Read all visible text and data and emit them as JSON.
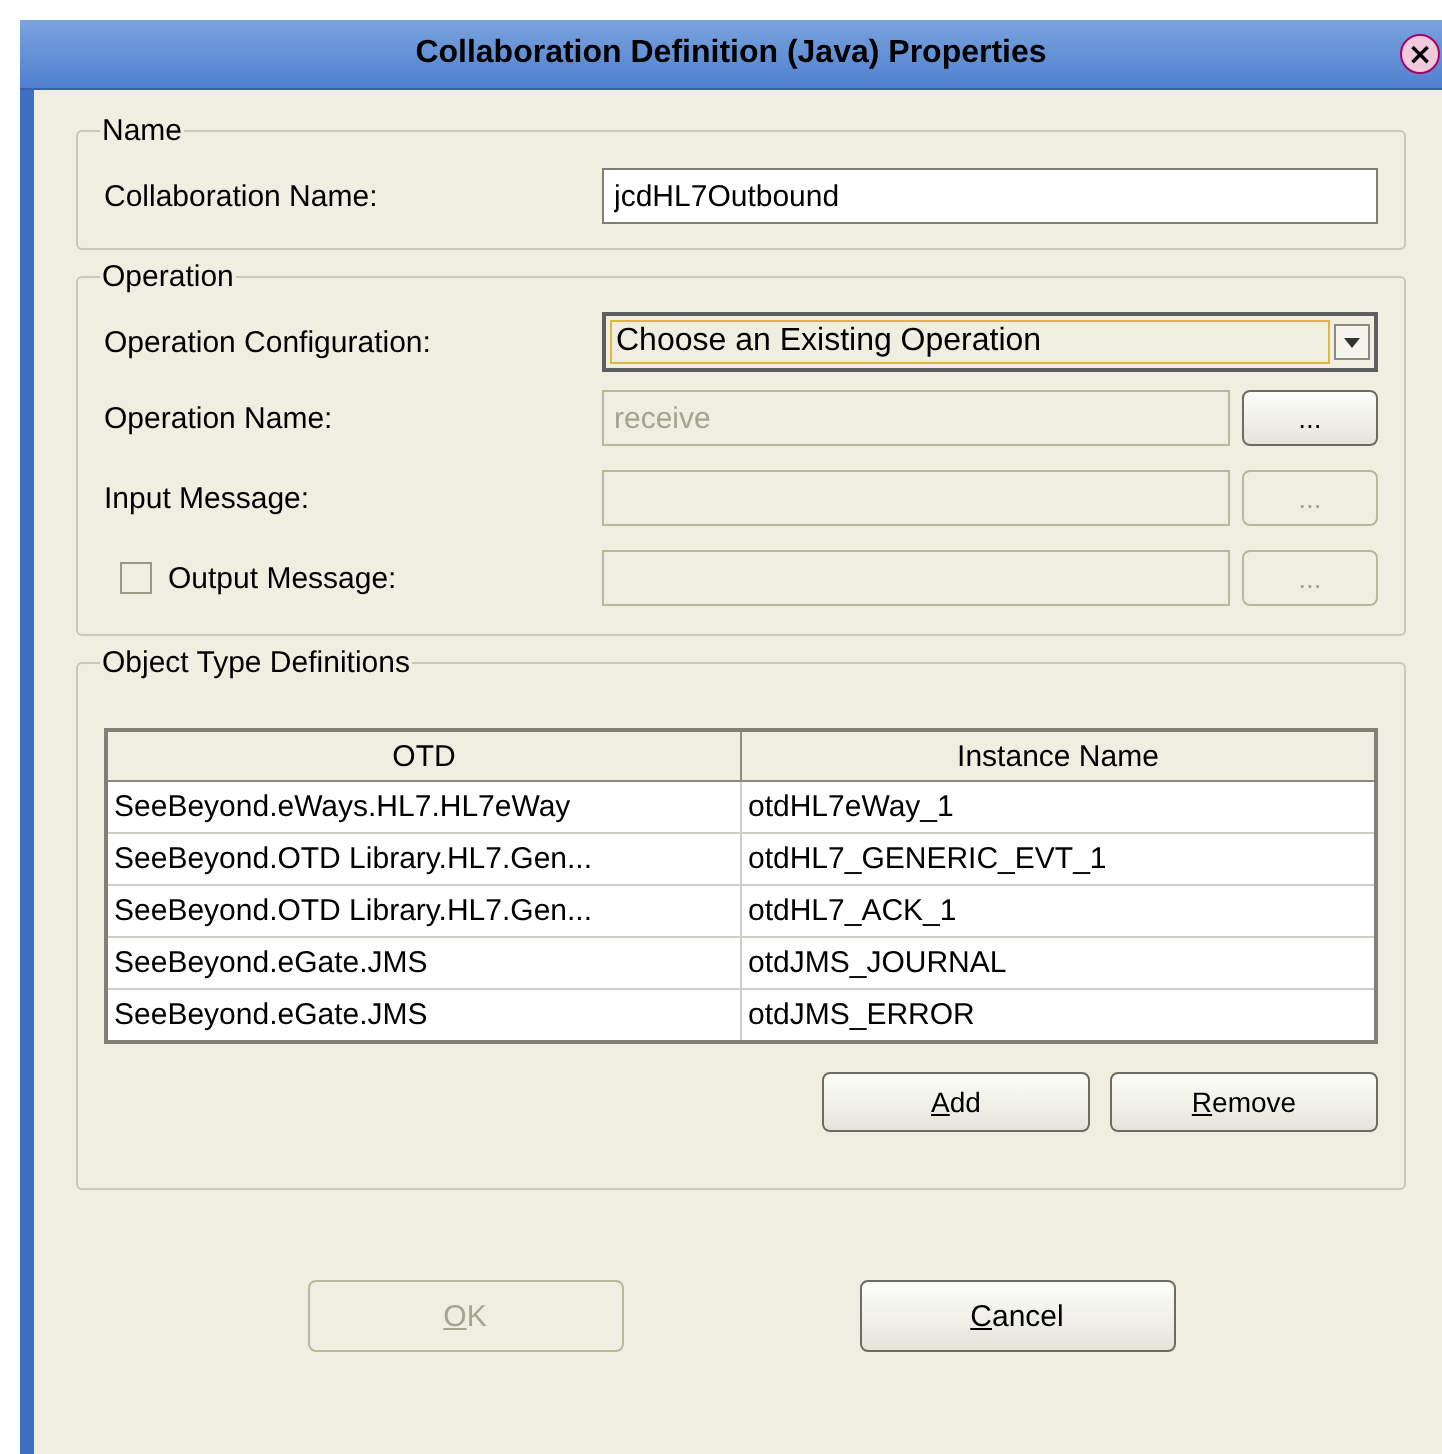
{
  "window": {
    "title": "Collaboration Definition (Java) Properties",
    "close": "×"
  },
  "name_group": {
    "legend": "Name",
    "label": "Collaboration Name:",
    "value": "jcdHL7Outbound"
  },
  "operation_group": {
    "legend": "Operation",
    "rows": [
      {
        "kind": "dropdown",
        "label": "Operation Configuration:",
        "value": "Choose an Existing Operation",
        "disabled": false
      },
      {
        "kind": "field",
        "label": "Operation Name:",
        "value": "receive",
        "disabled": true,
        "button": {
          "label": "...",
          "disabled": false
        }
      },
      {
        "kind": "field",
        "label": "Input Message:",
        "disabled": true,
        "button": {
          "label": "...",
          "disabled": true
        }
      },
      {
        "kind": "checkfield",
        "label": "Output Message:",
        "checked": false,
        "disabled": true,
        "button": {
          "label": "...",
          "disabled": true
        }
      }
    ]
  },
  "otd_group": {
    "legend": "Object Type Definitions",
    "table": {
      "columns": [
        "OTD",
        "Instance Name"
      ],
      "rows": [
        [
          "SeeBeyond.eWays.HL7.HL7eWay",
          "otdHL7eWay_1"
        ],
        [
          "SeeBeyond.OTD Library.HL7.Gen...",
          "otdHL7_GENERIC_EVT_1"
        ],
        [
          "SeeBeyond.OTD Library.HL7.Gen...",
          "otdHL7_ACK_1"
        ],
        [
          "SeeBeyond.eGate.JMS",
          "otdJMS_JOURNAL"
        ],
        [
          "SeeBeyond.eGate.JMS",
          "otdJMS_ERROR"
        ]
      ]
    },
    "buttons": [
      {
        "label": "Add",
        "underline": true,
        "disabled": false
      },
      {
        "label": "Remove",
        "underline": true,
        "disabled": false
      }
    ]
  },
  "buttons": [
    {
      "label": "OK",
      "underline": true,
      "disabled": true
    },
    {
      "label": "Cancel",
      "underline": true,
      "disabled": false
    }
  ]
}
